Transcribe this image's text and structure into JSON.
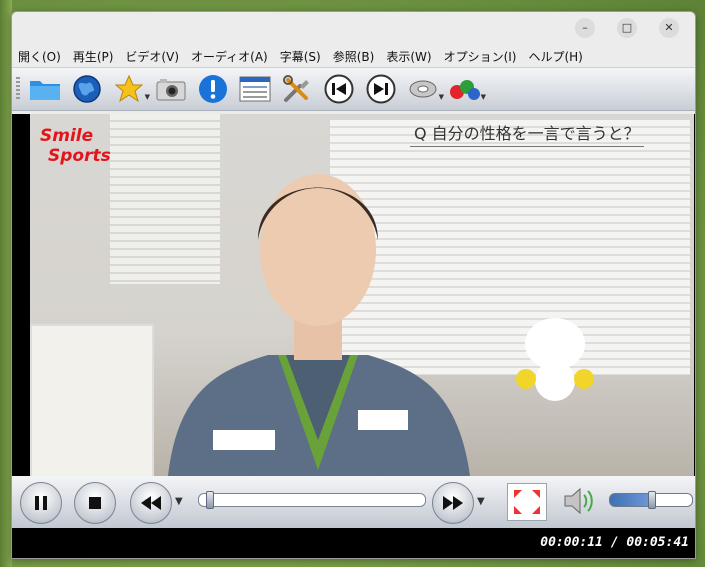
{
  "window": {
    "minimize_glyph": "–",
    "maximize_glyph": "□",
    "close_glyph": "✕"
  },
  "menu": [
    {
      "label": "開く(O)"
    },
    {
      "label": "再生(P)"
    },
    {
      "label": "ビデオ(V)"
    },
    {
      "label": "オーディオ(A)"
    },
    {
      "label": "字幕(S)"
    },
    {
      "label": "参照(B)"
    },
    {
      "label": "表示(W)"
    },
    {
      "label": "オプション(I)"
    },
    {
      "label": "ヘルプ(H)"
    }
  ],
  "toolbar": {
    "icons": [
      "folder-icon",
      "globe-icon",
      "favorites-star-icon",
      "screenshot-camera-icon",
      "info-icon",
      "playlist-icon",
      "tools-icon",
      "previous-icon",
      "next-icon",
      "audio-disc-icon",
      "subtitles-abc-icon"
    ]
  },
  "video": {
    "overlay_logo_line1": "Smile",
    "overlay_logo_line2": "Sports",
    "overlay_caption": "Q 自分の性格を一言で言うと？"
  },
  "controls": {
    "seek_progress": 0.034,
    "volume_level": 0.5
  },
  "status": {
    "current_time": "00:00:11",
    "separator": "/",
    "total_time": "00:05:41"
  },
  "colors": {
    "logo": "#e4141b",
    "volume_fill": "#3f6fb4"
  }
}
